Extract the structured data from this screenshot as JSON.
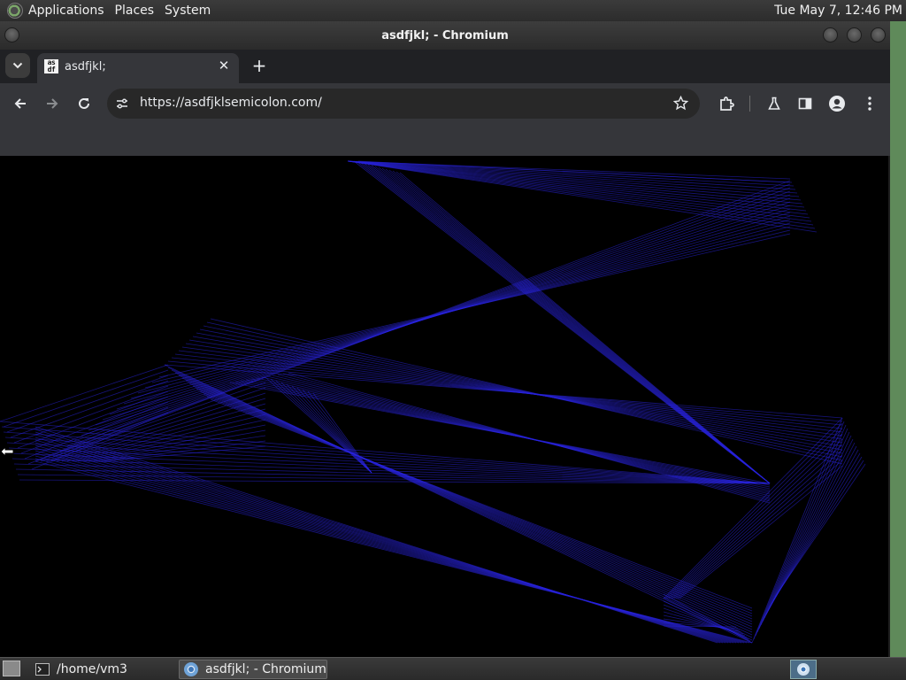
{
  "top_panel": {
    "menus": [
      "Applications",
      "Places",
      "System"
    ],
    "clock": "Tue May  7, 12:46 PM"
  },
  "window": {
    "title": "asdfjkl; - Chromium",
    "tab": {
      "title": "asdfjkl;",
      "favicon_text": [
        "as",
        "df"
      ]
    },
    "url": "https://asdfjklsemicolon.com/",
    "toolbar_icons": [
      "back-icon",
      "forward-icon",
      "reload-icon",
      "site-info-icon",
      "bookmark-star-icon",
      "extensions-icon",
      "labs-flask-icon",
      "side-panel-icon",
      "profile-icon",
      "menu-kebab-icon"
    ]
  },
  "page": {
    "background": "#000000",
    "line_color": "#2a25e0"
  },
  "taskbar": {
    "items": [
      {
        "label": "/home/vm3",
        "icon": "terminal-icon"
      },
      {
        "label": "asdfjkl; - Chromium",
        "icon": "chromium-icon"
      }
    ]
  }
}
